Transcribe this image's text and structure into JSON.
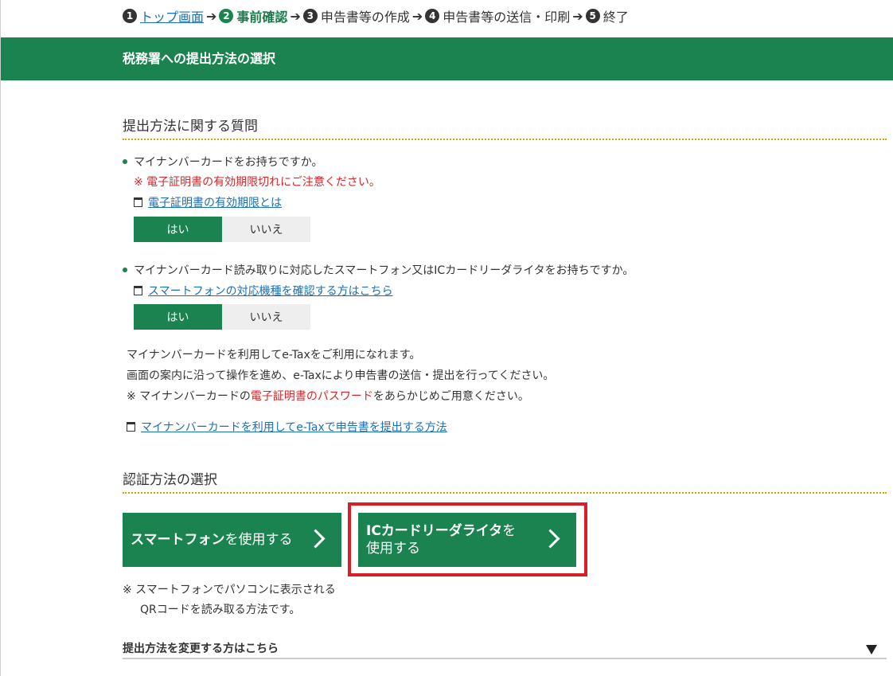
{
  "steps": [
    {
      "num": "1",
      "label": "トップ画面"
    },
    {
      "num": "2",
      "label": "事前確認"
    },
    {
      "num": "3",
      "label": "申告書等の作成"
    },
    {
      "num": "4",
      "label": "申告書等の送信・印刷"
    },
    {
      "num": "5",
      "label": "終了"
    }
  ],
  "step_arrow": "➔",
  "header": {
    "title": "税務署への提出方法の選択"
  },
  "section1": {
    "title": "提出方法に関する質問",
    "q1": {
      "text": "マイナンバーカードをお持ちですか。",
      "warning": "※ 電子証明書の有効期限切れにご注意ください。",
      "link": "電子証明書の有効期限とは",
      "yes": "はい",
      "no": "いいえ",
      "selected": "はい"
    },
    "q2": {
      "text": "マイナンバーカード読み取りに対応したスマートフォン又はICカードリーダライタをお持ちですか。",
      "link": "スマートフォンの対応機種を確認する方はこちら",
      "yes": "はい",
      "no": "いいえ",
      "selected": "はい"
    },
    "info_line1": "マイナンバーカードを利用してe-Taxをご利用になれます。",
    "info_line2": "画面の案内に沿って操作を進め、e-Taxにより申告書の送信・提出を行ってください。",
    "info_line3_pre": "※ マイナンバーカードの",
    "info_line3_red": "電子証明書のパスワード",
    "info_line3_post": "をあらかじめご用意ください。",
    "info_link": "マイナンバーカードを利用してe-Taxで申告書を提出する方法"
  },
  "section2": {
    "title": "認証方法の選択",
    "smartphone_btn_bold": "スマートフォン",
    "smartphone_btn_rest": "を使用する",
    "ic_btn_bold": "ICカードリーダライタ",
    "ic_btn_rest1": "を",
    "ic_btn_rest2": "使用する",
    "note_line1": "※ スマートフォンでパソコンに表示される",
    "note_line2": "QRコードを読み取る方法です。"
  },
  "footer": {
    "change_method": "提出方法を変更する方はこちら"
  },
  "colors": {
    "accent_green": "#1a8350",
    "warning_red": "#d6262a",
    "highlight_red": "#d91e27",
    "link_blue": "#1a6fb5",
    "dotted_gold": "#d9a400"
  },
  "icons": [
    "external-window-icon",
    "chevron-right-icon",
    "triangle-down-icon"
  ]
}
